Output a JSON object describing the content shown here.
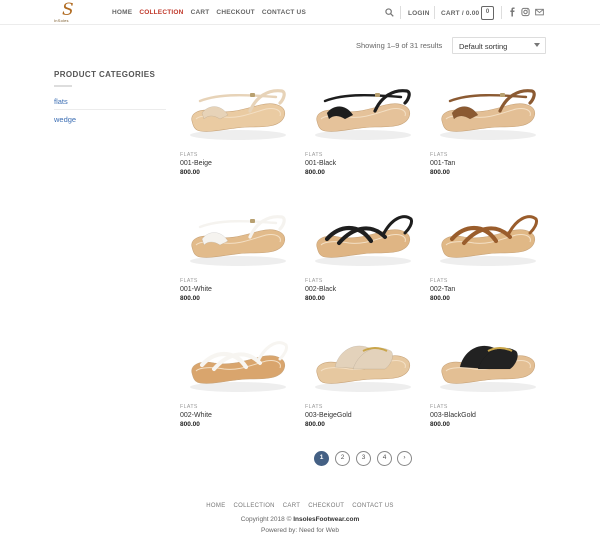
{
  "header": {
    "logo_text": "InSoles",
    "nav": [
      "HOME",
      "COLLECTION",
      "CART",
      "CHECKOUT",
      "CONTACT US"
    ],
    "active_nav": 1,
    "login": "LOGIN",
    "cart": "CART / 0.00",
    "cart_count": "0",
    "icons": [
      "search-icon",
      "facebook-icon",
      "instagram-icon",
      "email-icon"
    ]
  },
  "toolbar": {
    "showing": "Showing 1–9 of 31 results",
    "sort_selected": "Default sorting"
  },
  "sidebar": {
    "title": "PRODUCT CATEGORIES",
    "items": [
      "flats",
      "wedge"
    ]
  },
  "products": [
    {
      "category": "FLATS",
      "name": "001-Beige",
      "price": "800.00",
      "strap": "#e7d3b8",
      "sole": "#eacba2",
      "style": "ankle"
    },
    {
      "category": "FLATS",
      "name": "001-Black",
      "price": "800.00",
      "strap": "#1d1d1d",
      "sole": "#e5c29a",
      "style": "ankle"
    },
    {
      "category": "FLATS",
      "name": "001-Tan",
      "price": "800.00",
      "strap": "#8b5a32",
      "sole": "#e3bf95",
      "style": "ankle"
    },
    {
      "category": "FLATS",
      "name": "001-White",
      "price": "800.00",
      "strap": "#f5f3ef",
      "sole": "#e2bb8b",
      "style": "ankle"
    },
    {
      "category": "FLATS",
      "name": "002-Black",
      "price": "800.00",
      "strap": "#1e1e1e",
      "sole": "#dfb584",
      "style": "cross"
    },
    {
      "category": "FLATS",
      "name": "002-Tan",
      "price": "800.00",
      "strap": "#9a5d2c",
      "sole": "#e0b886",
      "style": "cross"
    },
    {
      "category": "FLATS",
      "name": "002-White",
      "price": "800.00",
      "strap": "#f7f5f1",
      "sole": "#d9a56d",
      "style": "cross"
    },
    {
      "category": "FLATS",
      "name": "003-BeigeGold",
      "price": "800.00",
      "strap": "#e3d2bb",
      "sole": "#e6c8a0",
      "style": "slide"
    },
    {
      "category": "FLATS",
      "name": "003-BlackGold",
      "price": "800.00",
      "strap": "#222222",
      "sole": "#e3bf94",
      "style": "slide"
    }
  ],
  "pagination": [
    "1",
    "2",
    "3",
    "4",
    "›"
  ],
  "pagination_current": 0,
  "footer": {
    "nav": [
      "HOME",
      "COLLECTION",
      "CART",
      "CHECKOUT",
      "CONTACT US"
    ],
    "copyright_prefix": "Copyright 2018 ©",
    "copyright_site": "InsolesFootwear.com",
    "powered": "Powered by: Need for Web"
  },
  "colors": {
    "accent": "#c0392b",
    "link": "#3d6fb4",
    "pager_active": "#446084"
  }
}
